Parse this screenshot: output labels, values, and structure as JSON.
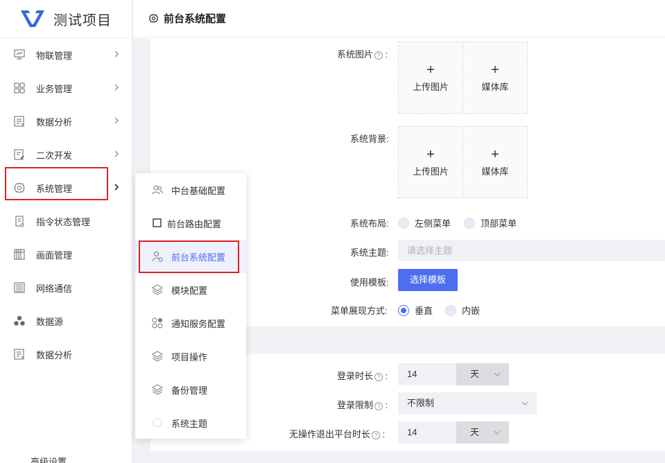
{
  "app": {
    "title": "测试项目"
  },
  "sidebar": {
    "items": [
      {
        "label": "物联管理",
        "icon": "monitor-icon",
        "chevron": true
      },
      {
        "label": "业务管理",
        "icon": "grid-icon",
        "chevron": true
      },
      {
        "label": "数据分析",
        "icon": "report-icon",
        "chevron": true
      },
      {
        "label": "二次开发",
        "icon": "edit-doc-icon",
        "chevron": true
      },
      {
        "label": "系统管理",
        "icon": "gear-icon",
        "chevron": true,
        "active": true
      },
      {
        "label": "指令状态管理",
        "icon": "scroll-icon",
        "chevron": false
      },
      {
        "label": "画面管理",
        "icon": "panel-icon",
        "chevron": false
      },
      {
        "label": "网络通信",
        "icon": "list-icon",
        "chevron": false
      },
      {
        "label": "数据源",
        "icon": "cluster-icon",
        "chevron": false
      },
      {
        "label": "数据分析",
        "icon": "report-icon",
        "chevron": false
      }
    ]
  },
  "flyout": {
    "items": [
      {
        "label": "中台基础配置",
        "icon": "users-icon"
      },
      {
        "label": "前台路由配置",
        "icon": "square-icon"
      },
      {
        "label": "前台系统配置",
        "icon": "user-settings-icon",
        "active": true
      },
      {
        "label": "模块配置",
        "icon": "layers-icon"
      },
      {
        "label": "通知服务配置",
        "icon": "apps-icon"
      },
      {
        "label": "项目操作",
        "icon": "layers-icon"
      },
      {
        "label": "备份管理",
        "icon": "layers-icon"
      },
      {
        "label": "系统主题",
        "icon": "theme-icon"
      }
    ]
  },
  "header": {
    "title": "前台系统配置"
  },
  "form": {
    "system_image": {
      "label": "系统图片",
      "upload": "上传图片",
      "library": "媒体库"
    },
    "system_bg": {
      "label": "系统背景",
      "upload": "上传图片",
      "library": "媒体库"
    },
    "layout": {
      "label": "系统布局",
      "options": [
        "左侧菜单",
        "顶部菜单"
      ]
    },
    "theme": {
      "label": "系统主题",
      "placeholder": "请选择主题"
    },
    "template": {
      "label": "使用模板",
      "button": "选择模板"
    },
    "menu_mode": {
      "label": "菜单展现方式",
      "options": [
        "垂直",
        "内嵌"
      ],
      "selected": "垂直"
    },
    "login_duration": {
      "label": "登录时长",
      "value": "14",
      "unit": "天"
    },
    "login_limit": {
      "label": "登录限制",
      "value": "不限制"
    },
    "idle_logout": {
      "label": "无操作退出平台时长",
      "value": "14",
      "unit": "天"
    },
    "advanced_title": "高级设置"
  },
  "colors": {
    "accent": "#4e6ef2",
    "highlight": "#e02020"
  }
}
